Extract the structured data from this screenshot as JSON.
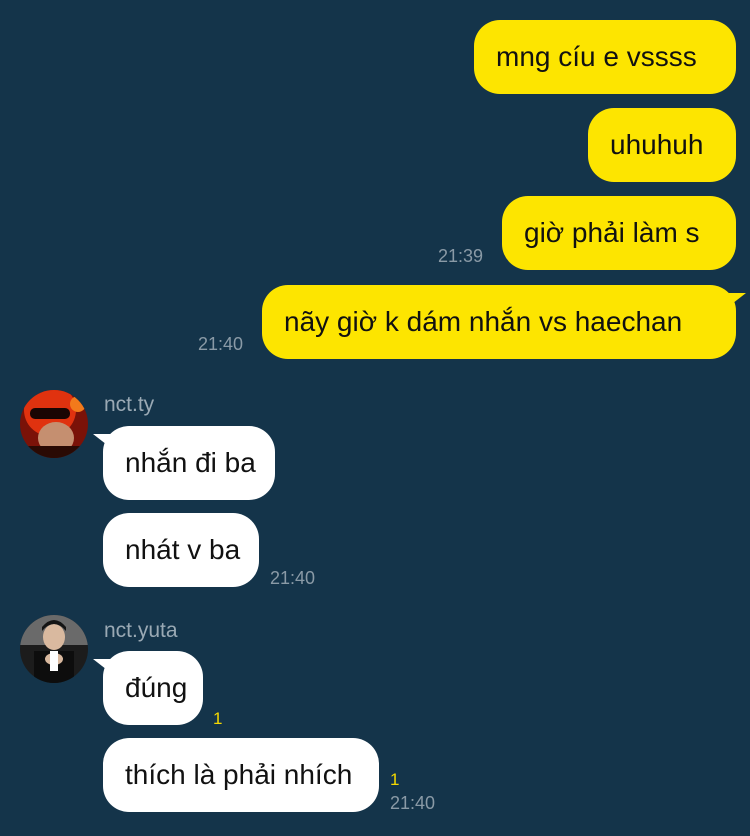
{
  "messages": [
    {
      "text": "mng cíu e vssss",
      "side": "mine"
    },
    {
      "text": "uhuhuh",
      "side": "mine"
    },
    {
      "text": "giờ phải làm s",
      "side": "mine",
      "time": "21:39"
    },
    {
      "text": "nãy giờ k dám nhắn vs haechan",
      "side": "mine",
      "time": "21:40"
    }
  ],
  "group_ty": {
    "sender": "nct.ty",
    "avatar_icon": "profile-avatar-red",
    "messages": [
      {
        "text": "nhắn đi ba"
      },
      {
        "text": "nhát v ba",
        "time": "21:40"
      }
    ]
  },
  "group_yuta": {
    "sender": "nct.yuta",
    "avatar_icon": "profile-avatar-dark",
    "messages": [
      {
        "text": "đúng",
        "unread": "1"
      },
      {
        "text": "thích là phải nhích",
        "unread": "1",
        "time": "21:40"
      }
    ]
  },
  "colors": {
    "background": "#14344a",
    "my_bubble": "#fde500",
    "their_bubble": "#ffffff",
    "unread_count": "#f5d800"
  }
}
